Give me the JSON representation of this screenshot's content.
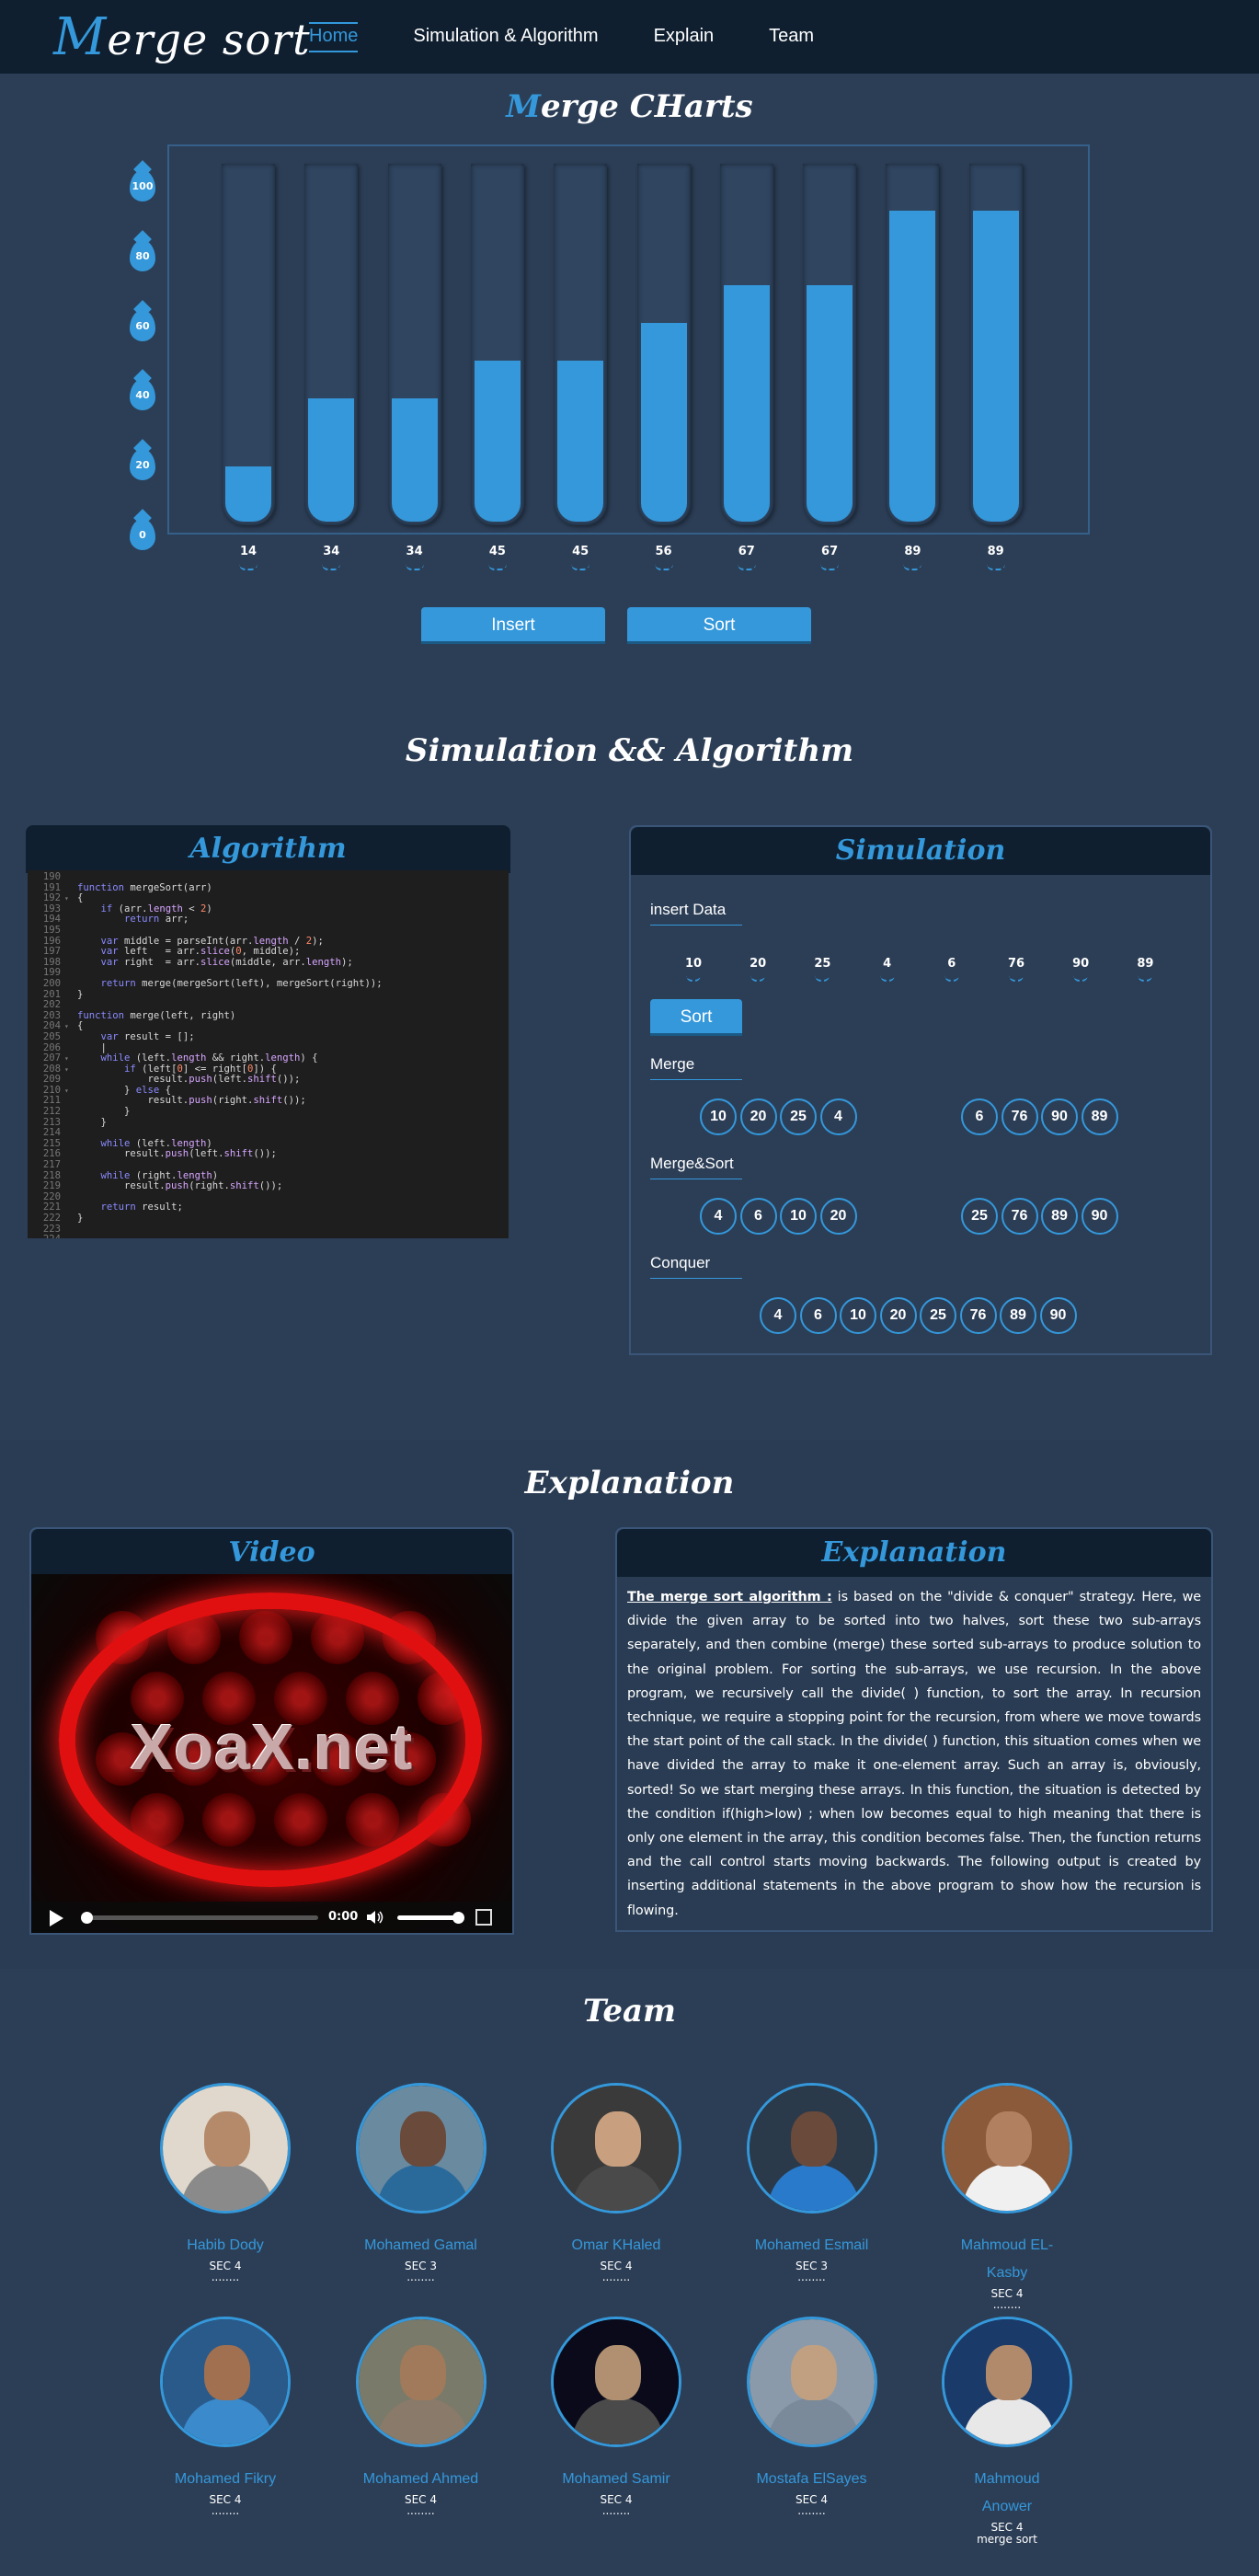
{
  "header": {
    "logo_first": "M",
    "logo_rest": "erge sort",
    "nav": [
      "Home",
      "Simulation & Algorithm",
      "Explain",
      "Team"
    ]
  },
  "chart_section": {
    "title_first": "M",
    "title_rest": "erge CHarts",
    "insert_label": "Insert",
    "sort_label": "Sort"
  },
  "chart_data": {
    "type": "bar",
    "categories": [
      "14",
      "34",
      "34",
      "45",
      "45",
      "56",
      "67",
      "67",
      "89",
      "89"
    ],
    "values": [
      14,
      34,
      34,
      45,
      45,
      56,
      67,
      67,
      89,
      89
    ],
    "yticks": [
      "100",
      "80",
      "60",
      "40",
      "20",
      "0"
    ],
    "ylim": [
      0,
      100
    ],
    "title": "Merge CHarts",
    "xlabel": "",
    "ylabel": ""
  },
  "sim_section": {
    "title": "Simulation && Algorithm",
    "algorithm_title": "Algorithm",
    "simulation_title": "Simulation",
    "insert_data_label": "insert Data",
    "data": [
      "10",
      "20",
      "25",
      "4",
      "6",
      "76",
      "90",
      "89"
    ],
    "sort_button": "Sort",
    "merge_label": "Merge",
    "merge_left": [
      "10",
      "20",
      "25",
      "4"
    ],
    "merge_right": [
      "6",
      "76",
      "90",
      "89"
    ],
    "merge_sort_label": "Merge&Sort",
    "mergesort_left": [
      "4",
      "6",
      "10",
      "20"
    ],
    "mergesort_right": [
      "25",
      "76",
      "89",
      "90"
    ],
    "conquer_label": "Conquer",
    "conquer": [
      "4",
      "6",
      "10",
      "20",
      "25",
      "76",
      "89",
      "90"
    ]
  },
  "code_lines": [
    {
      "n": "190",
      "f": "",
      "t": ""
    },
    {
      "n": "191",
      "f": "",
      "t": "<span class='kw'>function</span> mergeSort(arr)"
    },
    {
      "n": "192",
      "f": "▾",
      "t": "{"
    },
    {
      "n": "193",
      "f": "",
      "t": "    <span class='kw'>if</span> (arr.<span class='fn'>length</span> &lt; <span class='num'>2</span>)"
    },
    {
      "n": "194",
      "f": "",
      "t": "        <span class='kw'>return</span> arr;"
    },
    {
      "n": "195",
      "f": "",
      "t": ""
    },
    {
      "n": "196",
      "f": "",
      "t": "    <span class='kw'>var</span> middle = parseInt(arr.<span class='fn'>length</span> / <span class='num'>2</span>);"
    },
    {
      "n": "197",
      "f": "",
      "t": "    <span class='kw'>var</span> left   = arr.<span class='fn'>slice</span>(<span class='num'>0</span>, middle);"
    },
    {
      "n": "198",
      "f": "",
      "t": "    <span class='kw'>var</span> right  = arr.<span class='fn'>slice</span>(middle, arr.<span class='fn'>length</span>);"
    },
    {
      "n": "199",
      "f": "",
      "t": ""
    },
    {
      "n": "200",
      "f": "",
      "t": "    <span class='kw'>return</span> merge(mergeSort(left), mergeSort(right));"
    },
    {
      "n": "201",
      "f": "",
      "t": "}"
    },
    {
      "n": "202",
      "f": "",
      "t": ""
    },
    {
      "n": "203",
      "f": "",
      "t": "<span class='kw'>function</span> merge(left, right)"
    },
    {
      "n": "204",
      "f": "▾",
      "t": "{"
    },
    {
      "n": "205",
      "f": "",
      "t": "    <span class='kw'>var</span> result = [];"
    },
    {
      "n": "206",
      "f": "",
      "t": "    |"
    },
    {
      "n": "207",
      "f": "▾",
      "t": "    <span class='kw'>while</span> (left.<span class='fn'>length</span> &amp;&amp; right.<span class='fn'>length</span>) {"
    },
    {
      "n": "208",
      "f": "▾",
      "t": "        <span class='kw'>if</span> (left[<span class='num'>0</span>] &lt;= right[<span class='num'>0</span>]) {"
    },
    {
      "n": "209",
      "f": "",
      "t": "            result.<span class='fn'>push</span>(left.<span class='fn'>shift</span>());"
    },
    {
      "n": "210",
      "f": "▾",
      "t": "        } <span class='kw'>else</span> {"
    },
    {
      "n": "211",
      "f": "",
      "t": "            result.<span class='fn'>push</span>(right.<span class='fn'>shift</span>());"
    },
    {
      "n": "212",
      "f": "",
      "t": "        }"
    },
    {
      "n": "213",
      "f": "",
      "t": "    }"
    },
    {
      "n": "214",
      "f": "",
      "t": ""
    },
    {
      "n": "215",
      "f": "",
      "t": "    <span class='kw'>while</span> (left.<span class='fn'>length</span>)"
    },
    {
      "n": "216",
      "f": "",
      "t": "        result.<span class='fn'>push</span>(left.<span class='fn'>shift</span>());"
    },
    {
      "n": "217",
      "f": "",
      "t": ""
    },
    {
      "n": "218",
      "f": "",
      "t": "    <span class='kw'>while</span> (right.<span class='fn'>length</span>)"
    },
    {
      "n": "219",
      "f": "",
      "t": "        result.<span class='fn'>push</span>(right.<span class='fn'>shift</span>());"
    },
    {
      "n": "220",
      "f": "",
      "t": ""
    },
    {
      "n": "221",
      "f": "",
      "t": "    <span class='kw'>return</span> result;"
    },
    {
      "n": "222",
      "f": "",
      "t": "}"
    },
    {
      "n": "223",
      "f": "",
      "t": ""
    },
    {
      "n": "224",
      "f": "",
      "t": ""
    }
  ],
  "explain_section": {
    "title": "Explanation",
    "video_title": "Video",
    "panel_title": "Explanation",
    "video_logo": "XoaX.net",
    "video_time": "0:00",
    "lead": "The merge sort algorithm :",
    "body": " is based on the \"divide & conquer\" strategy. Here, we divide the given array to be sorted into two halves, sort these two sub-arrays separately, and then combine (merge) these sorted sub-arrays to produce solution to the original problem. For sorting the sub-arrays, we use recursion. In the above program, we recursively call the divide( ) function, to sort the array. In recursion technique, we require a stopping point for the recursion, from where we move towards the start point of the call stack. In the divide( ) function, this situation comes when we have divided the array to make it one-element array. Such an array is, obviously, sorted! So we start merging these arrays. In this function, the situation is detected by the condition if(high>low) ; when low becomes equal to high meaning that there is only one element in the array, this condition becomes false. Then, the function returns and the call control starts moving backwards. The following output is created by inserting additional statements in the above program to show how the recursion is flowing."
  },
  "team_section": {
    "title": "Team",
    "members": [
      {
        "name": "Habib Dody",
        "sec": "SEC 4",
        "dots": "........",
        "extra": ""
      },
      {
        "name": "Mohamed Gamal",
        "sec": "SEC 3",
        "dots": "........",
        "extra": ""
      },
      {
        "name": "Omar KHaled",
        "sec": "SEC 4",
        "dots": "........",
        "extra": ""
      },
      {
        "name": "Mohamed Esmail",
        "sec": "SEC 3",
        "dots": "........",
        "extra": ""
      },
      {
        "name": "Mahmoud EL-Kasby",
        "sec": "SEC 4",
        "dots": "........",
        "extra": ""
      },
      {
        "name": "Mohamed Fikry",
        "sec": "SEC 4",
        "dots": "........",
        "extra": ""
      },
      {
        "name": "Mohamed Ahmed",
        "sec": "SEC 4",
        "dots": "........",
        "extra": ""
      },
      {
        "name": "Mohamed Samir",
        "sec": "SEC 4",
        "dots": "........",
        "extra": ""
      },
      {
        "name": "Mostafa ElSayes",
        "sec": "SEC 4",
        "dots": "........",
        "extra": ""
      },
      {
        "name": "Mahmoud Anower",
        "sec": "SEC 4",
        "dots": "",
        "extra": "merge sort"
      }
    ]
  }
}
